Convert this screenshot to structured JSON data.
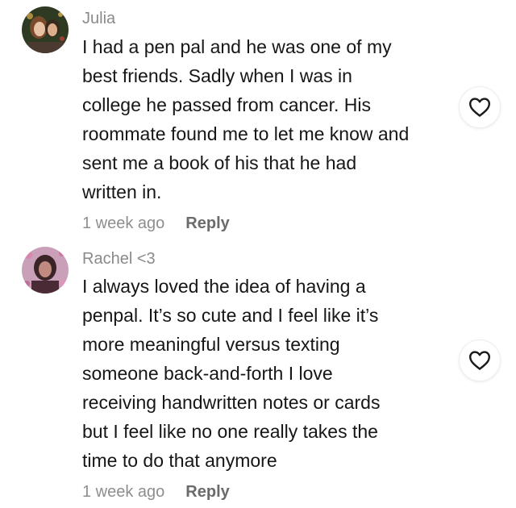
{
  "comments": [
    {
      "username": "Julia",
      "text_lines": [
        "I had a pen pal and he was one of my",
        "best friends. Sadly when I was in",
        "college he passed from cancer. His",
        "roommate found me to let me know and",
        "sent me a book of his that he had",
        "written in."
      ],
      "time": "1 week ago",
      "reply_label": "Reply",
      "like_icon": "heart-outline-icon",
      "avatar": "photo"
    },
    {
      "username": "Rachel <3",
      "text_lines": [
        "I always loved the idea of having a",
        "penpal. It’s so cute and I feel like it’s",
        "more meaningful versus texting",
        "someone back-and-forth I love",
        "receiving handwritten notes or cards",
        "but I feel like no one really takes the",
        "time to do that anymore"
      ],
      "time": "1 week ago",
      "reply_label": "Reply",
      "like_icon": "heart-outline-icon",
      "avatar": "photo"
    }
  ],
  "colors": {
    "username": "#8a8a8a",
    "body_text": "#161616",
    "meta_text": "#8e8e8e",
    "reply_text": "#6b6b6b"
  }
}
